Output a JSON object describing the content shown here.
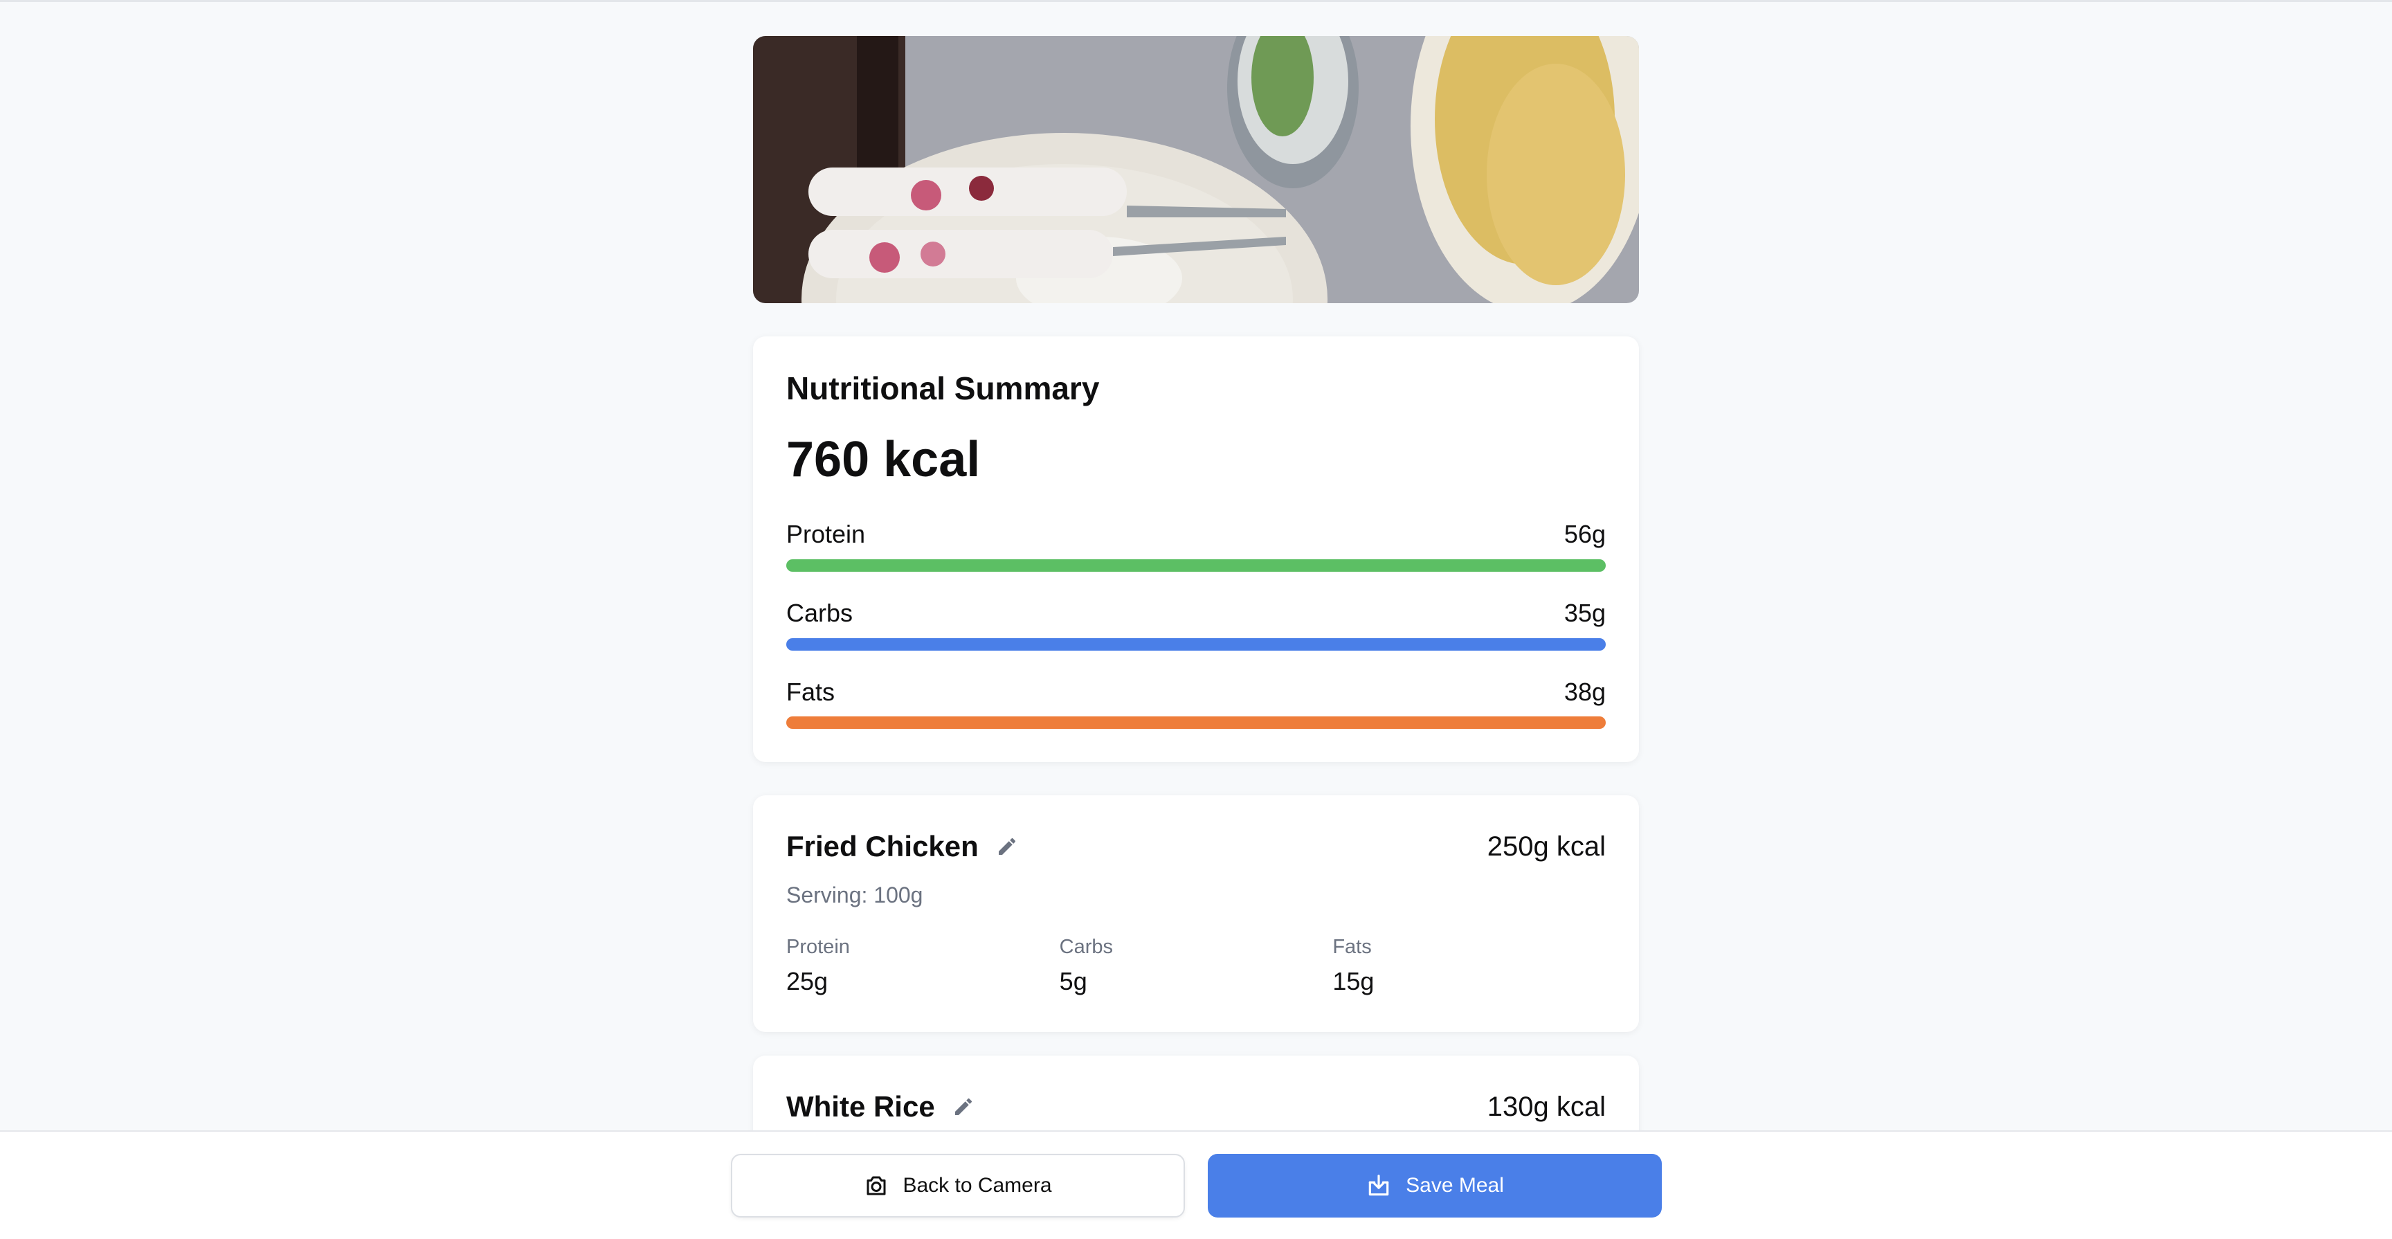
{
  "summary": {
    "title": "Nutritional Summary",
    "total": "760 kcal",
    "macros": [
      {
        "label": "Protein",
        "value": "56g",
        "color": "#5cbf64"
      },
      {
        "label": "Carbs",
        "value": "35g",
        "color": "#4a7fe8"
      },
      {
        "label": "Fats",
        "value": "38g",
        "color": "#ee7d3a"
      }
    ]
  },
  "foods": [
    {
      "name": "Fried Chicken",
      "kcal": "250g kcal",
      "serving": "Serving: 100g",
      "macros": [
        {
          "label": "Protein",
          "value": "25g"
        },
        {
          "label": "Carbs",
          "value": "5g"
        },
        {
          "label": "Fats",
          "value": "15g"
        }
      ]
    },
    {
      "name": "White Rice",
      "kcal": "130g kcal"
    }
  ],
  "actions": {
    "back": "Back to Camera",
    "save": "Save Meal"
  },
  "icons": {
    "edit": "pencil-icon",
    "camera": "camera-icon",
    "save": "download-tray-icon"
  }
}
